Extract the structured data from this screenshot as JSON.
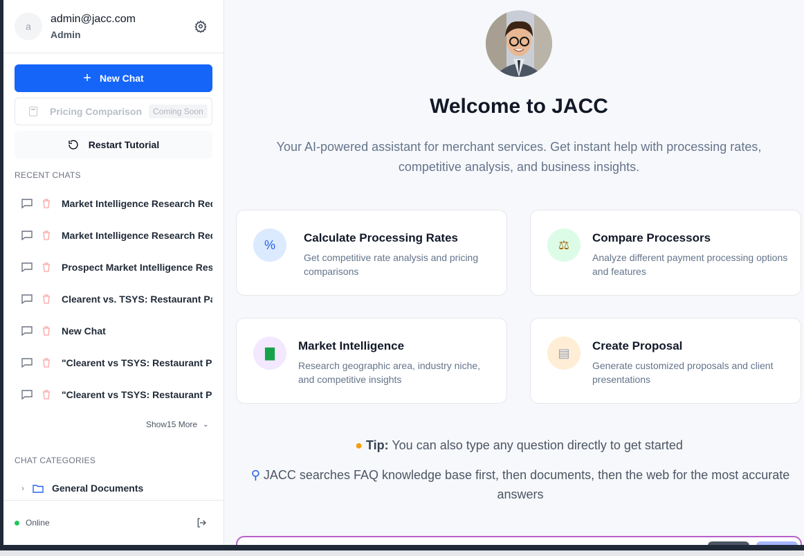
{
  "user": {
    "initial": "a",
    "email": "admin@jacc.com",
    "role": "Admin"
  },
  "sidebar": {
    "new_chat_label": "New Chat",
    "pricing_label": "Pricing Comparison",
    "pricing_badge": "Coming Soon",
    "restart_label": "Restart Tutorial",
    "recent_chats_heading": "RECENT CHATS",
    "recent_chats": [
      "Market Intelligence Research Requ",
      "Market Intelligence Research Requ",
      "Prospect Market Intelligence Resea",
      "Clearent vs. TSYS: Restaurant Paym",
      "New Chat",
      "\"Clearent vs TSYS: Restaurant Paym",
      "\"Clearent vs TSYS: Restaurant Paym"
    ],
    "show_more_prefix": "Show",
    "show_more_suffix": "15 More",
    "categories_heading": "CHAT CATEGORIES",
    "categories": [
      "General Documents"
    ],
    "status": "Online"
  },
  "main": {
    "title": "Welcome to JACC",
    "subtitle": "Your AI-powered assistant for merchant services. Get instant help with processing rates, competitive analysis, and business insights.",
    "cards": [
      {
        "title": "Calculate Processing Rates",
        "desc": "Get competitive rate analysis and pricing comparisons",
        "icon": "percent-icon",
        "icon_glyph": "%",
        "icon_bg": "#dbeafe",
        "icon_color": "#2563eb"
      },
      {
        "title": "Compare Processors",
        "desc": "Analyze different payment processing options and features",
        "icon": "scales-icon",
        "icon_glyph": "⚖",
        "icon_bg": "#dcfce7",
        "icon_color": "#a16207"
      },
      {
        "title": "Market Intelligence",
        "desc": "Research geographic area, industry niche, and competitive insights",
        "icon": "bar-chart-icon",
        "icon_glyph": "▇",
        "icon_bg": "#f3e8ff",
        "icon_color": "#16a34a"
      },
      {
        "title": "Create Proposal",
        "desc": "Generate customized proposals and client presentations",
        "icon": "document-icon",
        "icon_glyph": "▤",
        "icon_bg": "#ffedd5",
        "icon_color": "#94a3b8"
      }
    ],
    "tip_label": "Tip:",
    "tip_text": " You can also type any question directly to get started",
    "note_text": "JACC searches FAQ knowledge base first, then documents, then the web for the most accurate answers"
  },
  "colors": {
    "primary": "#1565f9",
    "online": "#22c55e",
    "input_border": "#b660c9"
  }
}
